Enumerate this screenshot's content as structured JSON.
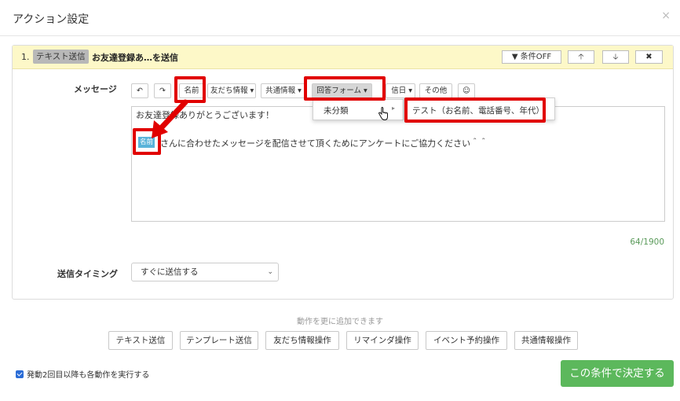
{
  "modal": {
    "title": "アクション設定",
    "close_glyph": "×"
  },
  "card": {
    "step_num": "1.",
    "step_type": "テキスト送信",
    "step_title": "お友達登録あ…を送信",
    "buttons": {
      "condition": "▼ 条件OFF",
      "up": "🡡",
      "down": "🡣",
      "delete": "✖"
    }
  },
  "message": {
    "label": "メッセージ",
    "toolbar": {
      "undo": "↶",
      "redo": "↷",
      "name": "名前",
      "friend_info": "友だち情報 ▾",
      "shared_info": "共通情報 ▾",
      "answer_form": "回答フォーム ▾",
      "date": "信日 ▾",
      "other": "その他",
      "emoji": "☺"
    },
    "editor": {
      "line1": "お友達登録ありがとうございます！",
      "name_chip": "名前",
      "line2": "さんに合わせたメッセージを配信させて頂くためにアンケートにご協力ください＾＾"
    },
    "char_count": "64/1900"
  },
  "dropdown": {
    "category": "未分類",
    "category_caret": "▸",
    "form_item": "テスト（お名前、電話番号、年代）"
  },
  "timing": {
    "label": "送信タイミング",
    "value": "すぐに送信する"
  },
  "add_actions": {
    "note": "動作を更に追加できます",
    "buttons": [
      "テキスト送信",
      "テンプレート送信",
      "友だち情報操作",
      "リマインダ操作",
      "イベント予約操作",
      "共通情報操作"
    ]
  },
  "footer": {
    "repeat_checkbox_label": "発動2回目以降も各動作を実行する",
    "submit": "この条件で決定する"
  },
  "colors": {
    "highlight": "#e10000",
    "submit_green": "#5cb85c",
    "card_header_yellow": "#fdf8c8"
  }
}
